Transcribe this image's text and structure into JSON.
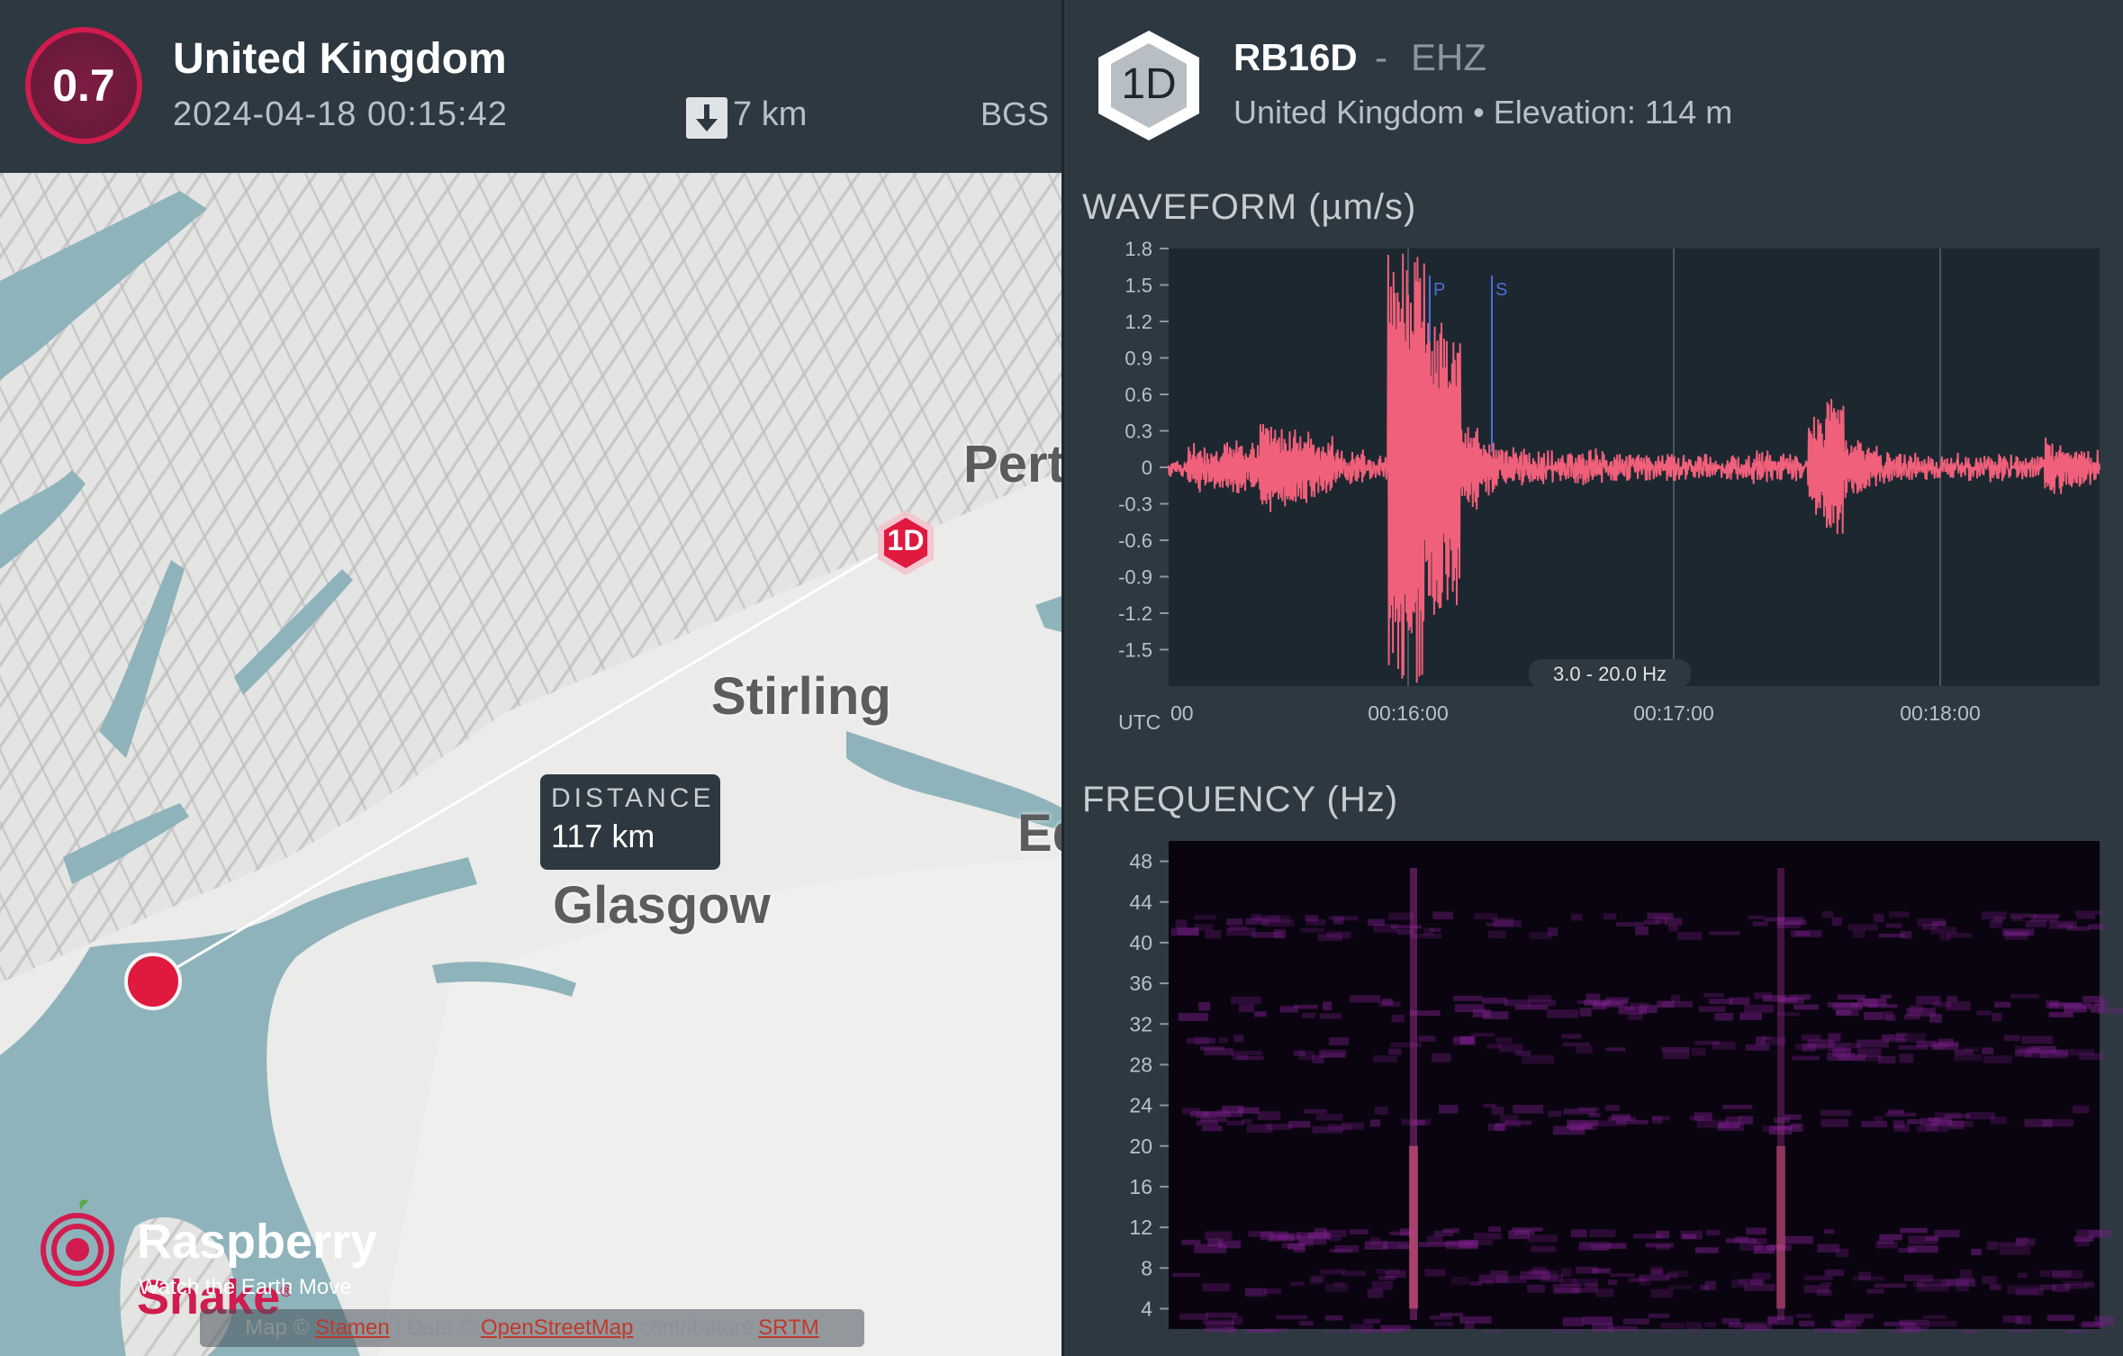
{
  "event": {
    "magnitude": "0.7",
    "location": "United Kingdom",
    "datetime": "2024-04-18 00:15:42",
    "depth": "7 km",
    "source": "BGS",
    "depth_icon": "arrow-down-icon"
  },
  "map": {
    "cities": [
      "Pert",
      "Stirling",
      "Ed",
      "Glasgow"
    ],
    "station_marker": "1D",
    "distance_label": "DISTANCE",
    "distance_value": "117 km",
    "colors": {
      "epicenter": "#e0193f",
      "water": "#8eb3bb",
      "land": "#e6e6e4"
    }
  },
  "logo": {
    "name_part1": "Raspberry ",
    "name_part2": "Shake",
    "tagline": "Watch the Earth Move",
    "registered": "®"
  },
  "attribution": {
    "map_prefix": "Map ©",
    "map_link": "Stamen",
    "data_prefix": "| Data ©",
    "data_link": "OpenStreetMap",
    "contributors": "contributors",
    "srtm_link": "SRTM"
  },
  "station": {
    "badge": "1D",
    "code": "RB16D",
    "separator": "-",
    "channel": "EHZ",
    "location": "United Kingdom",
    "bullet": "•",
    "elevation": "Elevation: 114 m"
  },
  "waveform": {
    "title": "WAVEFORM (µm/s)",
    "filter": "3.0 - 20.0 Hz",
    "utc_label": "UTC",
    "phase_labels": [
      "P",
      "S"
    ],
    "trace_color": "#f0607a"
  },
  "frequency": {
    "title": "FREQUENCY (Hz)"
  },
  "chart_data": [
    {
      "type": "line",
      "title": "WAVEFORM (µm/s)",
      "y_ticks": [
        "1.8",
        "1.5",
        "1.2",
        "0.9",
        "0.6",
        "0.3",
        "0",
        "-0.3",
        "-0.6",
        "-0.9",
        "-1.2",
        "-1.5"
      ],
      "x_ticks": [
        "00",
        "00:16:00",
        "00:17:00",
        "00:18:00"
      ],
      "ylim": [
        -1.8,
        1.8
      ],
      "grid": true,
      "series": [
        {
          "values": [
            0.02,
            0.15,
            -0.12,
            0.2,
            -0.15,
            0.35,
            -0.3,
            0.25,
            -0.2,
            0.1,
            -0.08,
            0.05,
            1.78,
            -1.75,
            1.2,
            -1.1,
            0.3,
            -0.2,
            0.12,
            -0.1,
            0.08,
            -0.06,
            0.1,
            -0.09,
            0.07,
            -0.05,
            0.06,
            -0.06,
            0.05,
            -0.05,
            0.06,
            -0.05,
            0.08,
            -0.07,
            0.05,
            0.38,
            -0.55,
            0.2,
            -0.15,
            0.08,
            -0.06,
            0.05,
            -0.04,
            0.06,
            -0.05,
            0.07,
            -0.06,
            0.05,
            0.18,
            -0.12,
            0.1,
            -0.08
          ]
        }
      ],
      "phase_markers": [
        {
          "label": "P",
          "x": "00:15:54"
        },
        {
          "label": "S",
          "x": "00:16:08"
        }
      ]
    },
    {
      "type": "heatmap",
      "title": "FREQUENCY (Hz)",
      "y_ticks": [
        "48",
        "44",
        "40",
        "36",
        "32",
        "28",
        "24",
        "20",
        "16",
        "12",
        "8",
        "4"
      ],
      "ylim": [
        2,
        50
      ]
    }
  ]
}
